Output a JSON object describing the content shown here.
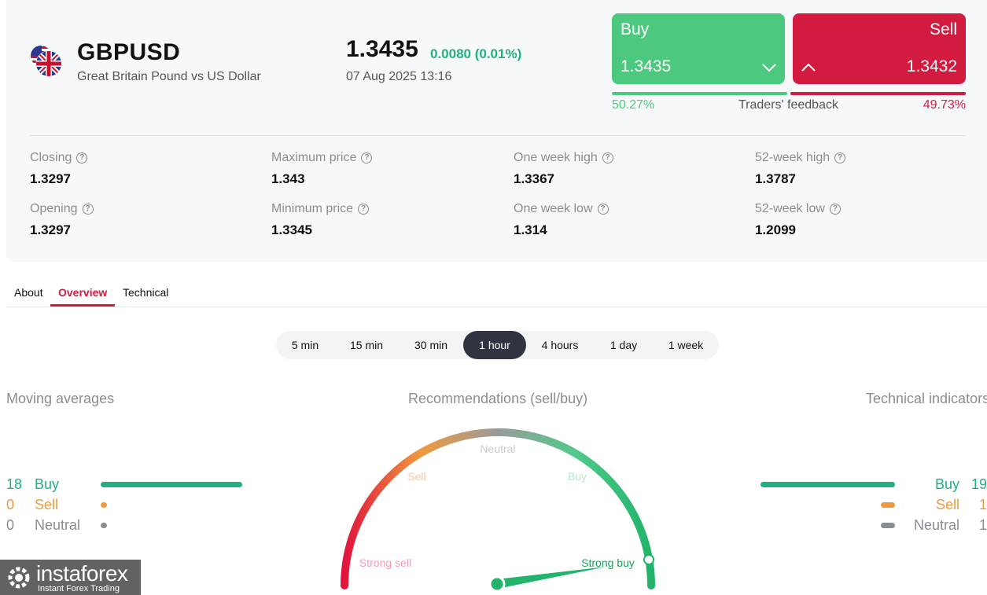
{
  "instrument": {
    "symbol": "GBPUSD",
    "description": "Great Britain Pound vs US Dollar",
    "price": "1.3435",
    "change": "0.0080 (0.01%)",
    "datetime": "07 Aug 2025 13:16"
  },
  "trade": {
    "buy_label": "Buy",
    "buy_price": "1.3435",
    "sell_label": "Sell",
    "sell_price": "1.3432"
  },
  "feedback": {
    "title": "Traders' feedback",
    "buy_percent": "50.27%",
    "sell_percent": "49.73%",
    "buy_share": 0.5027
  },
  "stats": [
    {
      "label": "Closing",
      "value": "1.3297"
    },
    {
      "label": "Opening",
      "value": "1.3297"
    },
    {
      "label": "Maximum price",
      "value": "1.343"
    },
    {
      "label": "Minimum price",
      "value": "1.3345"
    },
    {
      "label": "One week high",
      "value": "1.3367"
    },
    {
      "label": "One week low",
      "value": "1.314"
    },
    {
      "label": "52-week high",
      "value": "1.3787"
    },
    {
      "label": "52-week low",
      "value": "1.2099"
    }
  ],
  "tabs": [
    {
      "label": "About"
    },
    {
      "label": "Overview",
      "active": true
    },
    {
      "label": "Technical"
    }
  ],
  "periods": [
    {
      "label": "5 min"
    },
    {
      "label": "15 min"
    },
    {
      "label": "30 min"
    },
    {
      "label": "1 hour",
      "active": true
    },
    {
      "label": "4 hours"
    },
    {
      "label": "1 day"
    },
    {
      "label": "1 week"
    }
  ],
  "moving_averages": {
    "title": "Moving averages",
    "buy": {
      "count": "18",
      "label": "Buy"
    },
    "sell": {
      "count": "0",
      "label": "Sell"
    },
    "neutral": {
      "count": "0",
      "label": "Neutral"
    }
  },
  "recommendations": {
    "title": "Recommendations (sell/buy)",
    "labels": {
      "strong_sell": "Strong sell",
      "sell": "Sell",
      "neutral": "Neutral",
      "buy": "Buy",
      "strong_buy": "Strong buy"
    },
    "needle_value": 0.95
  },
  "technical_indicators": {
    "title": "Technical indicators",
    "buy": {
      "count": "19",
      "label": "Buy"
    },
    "sell": {
      "count": "1",
      "label": "Sell"
    },
    "neutral": {
      "count": "1",
      "label": "Neutral"
    }
  },
  "logo": {
    "brand": "instaforex",
    "tagline": "Instant Forex Trading"
  },
  "colors": {
    "buy": "#4cc97f",
    "sell": "#d31a3f",
    "positive": "#21b07e",
    "warning": "#ee9a3e",
    "neutral": "#8a8d93"
  }
}
